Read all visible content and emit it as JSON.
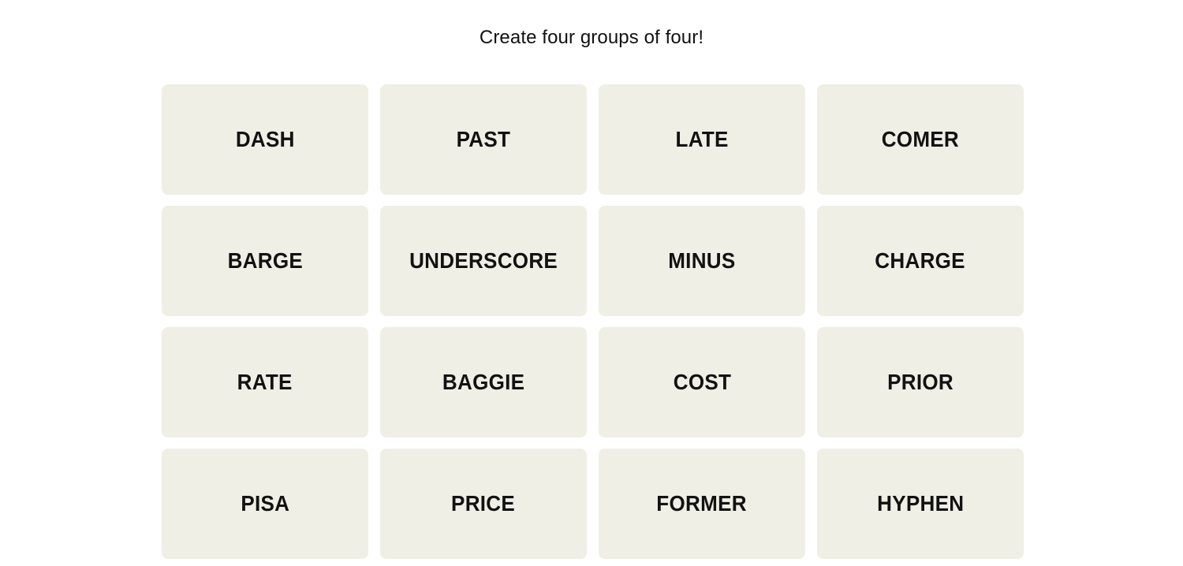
{
  "page": {
    "background_color": "#ffffff",
    "title": "Create four groups of four!"
  },
  "board": {
    "tile_background_color": "#efefe6",
    "tile_text_color": "#121212",
    "rows": 4,
    "columns": 4,
    "tiles": [
      {
        "label": "DASH"
      },
      {
        "label": "PAST"
      },
      {
        "label": "LATE"
      },
      {
        "label": "COMER"
      },
      {
        "label": "BARGE"
      },
      {
        "label": "UNDERSCORE"
      },
      {
        "label": "MINUS"
      },
      {
        "label": "CHARGE"
      },
      {
        "label": "RATE"
      },
      {
        "label": "BAGGIE"
      },
      {
        "label": "COST"
      },
      {
        "label": "PRIOR"
      },
      {
        "label": "PISA"
      },
      {
        "label": "PRICE"
      },
      {
        "label": "FORMER"
      },
      {
        "label": "HYPHEN"
      }
    ]
  }
}
